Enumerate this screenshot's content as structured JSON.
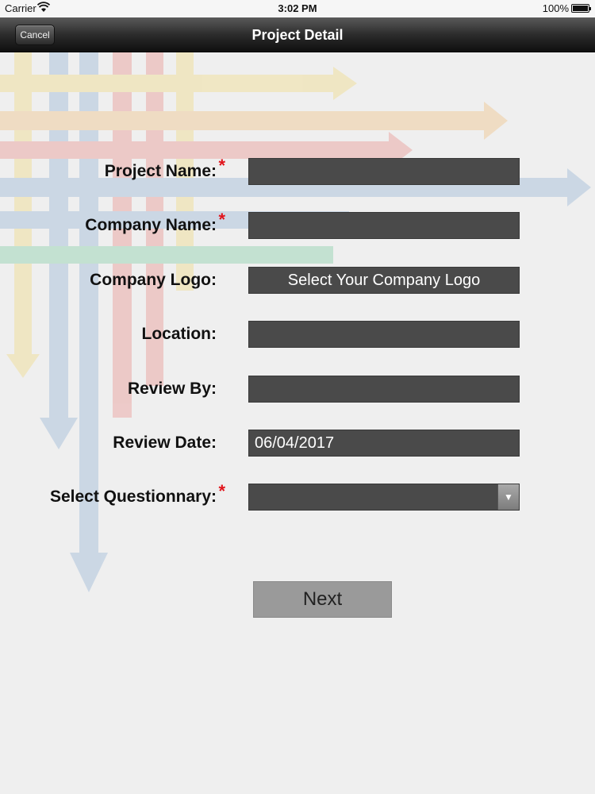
{
  "status_bar": {
    "carrier": "Carrier",
    "time": "3:02 PM",
    "battery": "100%"
  },
  "nav_bar": {
    "title": "Project Detail",
    "cancel_label": "Cancel"
  },
  "form": {
    "project_name": {
      "label": "Project Name:",
      "required": "*",
      "value": ""
    },
    "company_name": {
      "label": "Company Name:",
      "required": "*",
      "value": ""
    },
    "company_logo": {
      "label": "Company Logo:",
      "button_text": "Select Your Company Logo"
    },
    "location": {
      "label": "Location:",
      "value": ""
    },
    "review_by": {
      "label": "Review By:",
      "value": ""
    },
    "review_date": {
      "label": "Review Date:",
      "value": "06/04/2017"
    },
    "questionnary": {
      "label": "Select Questionnary:",
      "required": "*",
      "value": ""
    }
  },
  "next_label": "Next",
  "colors": {
    "required": "#e1141b",
    "field_bg": "#4a4a4a",
    "nav_bg": "#1e1e1e",
    "button_bg": "#9a9a9a"
  },
  "icons": {
    "wifi": "wifi-icon",
    "battery": "battery-icon",
    "dropdown": "chevron-down-icon"
  }
}
